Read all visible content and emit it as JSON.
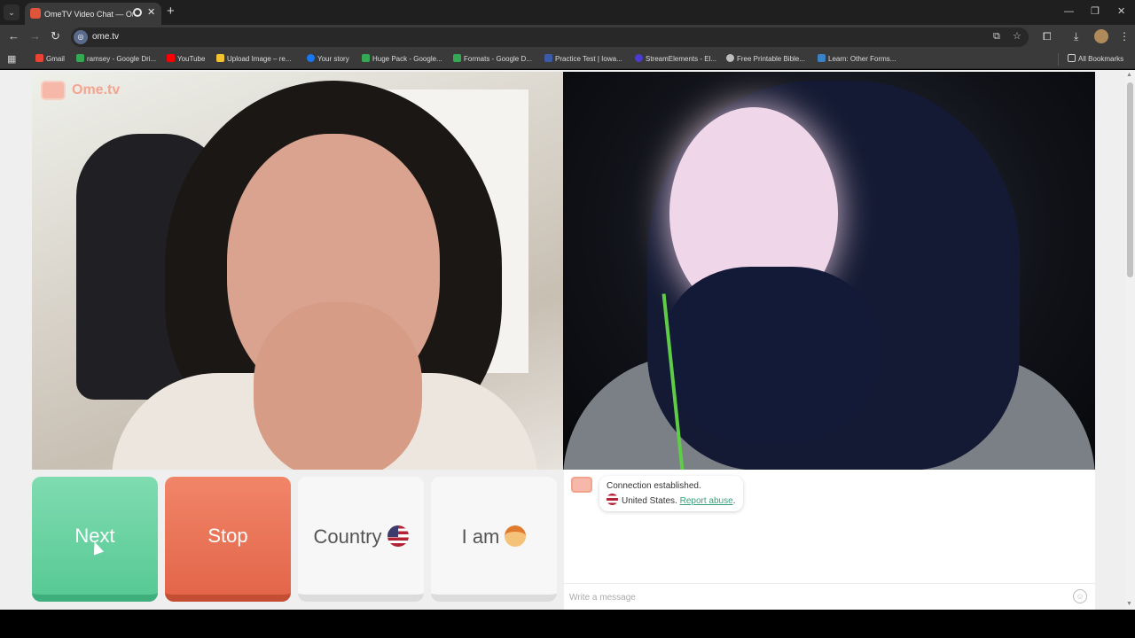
{
  "browser": {
    "tab_title": "OmeTV Video Chat — Ome",
    "url": "ome.tv",
    "bookmarks": [
      {
        "label": "Gmail"
      },
      {
        "label": "ramsey - Google Dri..."
      },
      {
        "label": "YouTube"
      },
      {
        "label": "Upload Image – re..."
      },
      {
        "label": "Your story"
      },
      {
        "label": "Huge Pack - Google..."
      },
      {
        "label": "Formats - Google D..."
      },
      {
        "label": "Practice Test | Iowa..."
      },
      {
        "label": "StreamElements - El..."
      },
      {
        "label": "Free Printable Bible..."
      },
      {
        "label": "Learn: Other Forms..."
      }
    ],
    "all_bookmarks": "All Bookmarks"
  },
  "app": {
    "logo_text": "Ome.tv",
    "buttons": {
      "next": "Next",
      "stop": "Stop",
      "country": "Country",
      "iam": "I am"
    },
    "chat": {
      "status": "Connection established.",
      "country_line": "United States.",
      "report_link": "Report abuse",
      "period": ".",
      "input_placeholder": "Write a message"
    }
  },
  "icons": {
    "country_flag": "us-flag-icon",
    "iam_avatar": "boy-emoji-icon"
  },
  "colors": {
    "next": "#58c995",
    "stop": "#e3664a",
    "link": "#3aa07a",
    "brand": "#f4a48f"
  }
}
